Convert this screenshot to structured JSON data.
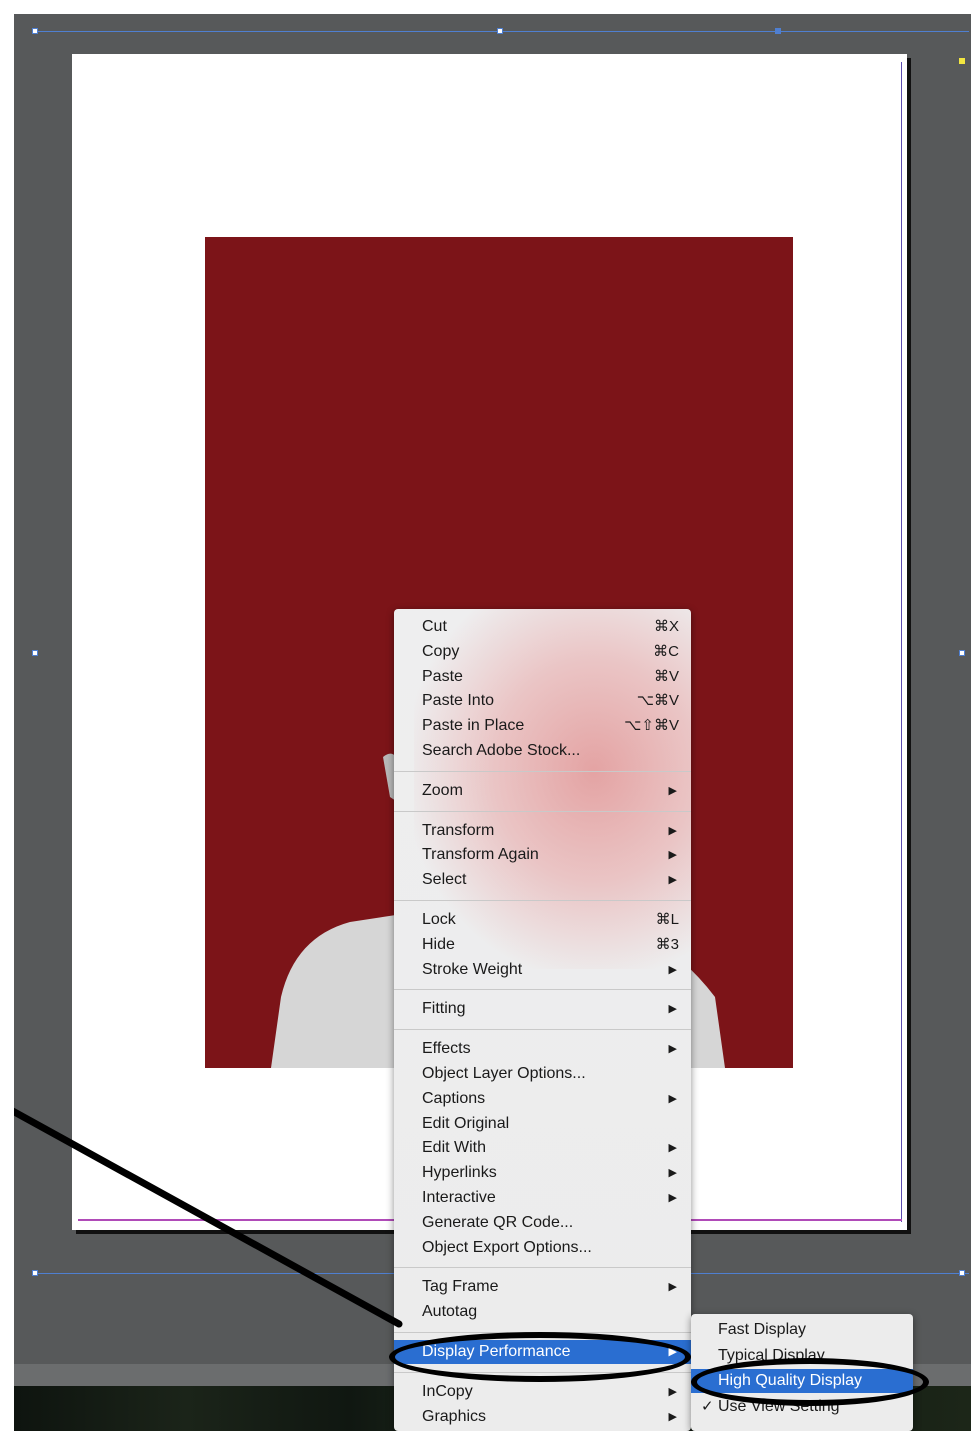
{
  "menu": {
    "groups": [
      [
        {
          "label": "Cut",
          "shortcut": "⌘X"
        },
        {
          "label": "Copy",
          "shortcut": "⌘C"
        },
        {
          "label": "Paste",
          "shortcut": "⌘V"
        },
        {
          "label": "Paste Into",
          "shortcut": "⌥⌘V"
        },
        {
          "label": "Paste in Place",
          "shortcut": "⌥⇧⌘V"
        },
        {
          "label": "Search Adobe Stock...",
          "shortcut": ""
        }
      ],
      [
        {
          "label": "Zoom",
          "submenu": true
        }
      ],
      [
        {
          "label": "Transform",
          "submenu": true
        },
        {
          "label": "Transform Again",
          "submenu": true
        },
        {
          "label": "Select",
          "submenu": true
        }
      ],
      [
        {
          "label": "Lock",
          "shortcut": "⌘L"
        },
        {
          "label": "Hide",
          "shortcut": "⌘3"
        },
        {
          "label": "Stroke Weight",
          "submenu": true
        }
      ],
      [
        {
          "label": "Fitting",
          "submenu": true
        }
      ],
      [
        {
          "label": "Effects",
          "submenu": true
        },
        {
          "label": "Object Layer Options...",
          "shortcut": ""
        },
        {
          "label": "Captions",
          "submenu": true
        },
        {
          "label": "Edit Original",
          "shortcut": ""
        },
        {
          "label": "Edit With",
          "submenu": true
        },
        {
          "label": "Hyperlinks",
          "submenu": true
        },
        {
          "label": "Interactive",
          "submenu": true
        },
        {
          "label": "Generate QR Code...",
          "shortcut": ""
        },
        {
          "label": "Object Export Options...",
          "shortcut": ""
        }
      ],
      [
        {
          "label": "Tag Frame",
          "submenu": true
        },
        {
          "label": "Autotag",
          "shortcut": ""
        }
      ],
      [
        {
          "label": "Display Performance",
          "submenu": true,
          "highlighted": true
        }
      ],
      [
        {
          "label": "InCopy",
          "submenu": true
        },
        {
          "label": "Graphics",
          "submenu": true
        }
      ]
    ]
  },
  "submenu": {
    "items": [
      {
        "label": "Fast Display",
        "checked": false
      },
      {
        "label": "Typical Display",
        "checked": false
      },
      {
        "label": "High Quality Display",
        "checked": false,
        "highlighted": true
      },
      {
        "label": "Use View Setting",
        "checked": true
      }
    ]
  },
  "glyphs": {
    "arrow": "▶",
    "check": "✓"
  },
  "colors": {
    "highlight": "#2a6ed1",
    "frame_fill": "#7c1418",
    "pasteboard": "#57595a",
    "guide": "#4f7fd0"
  }
}
